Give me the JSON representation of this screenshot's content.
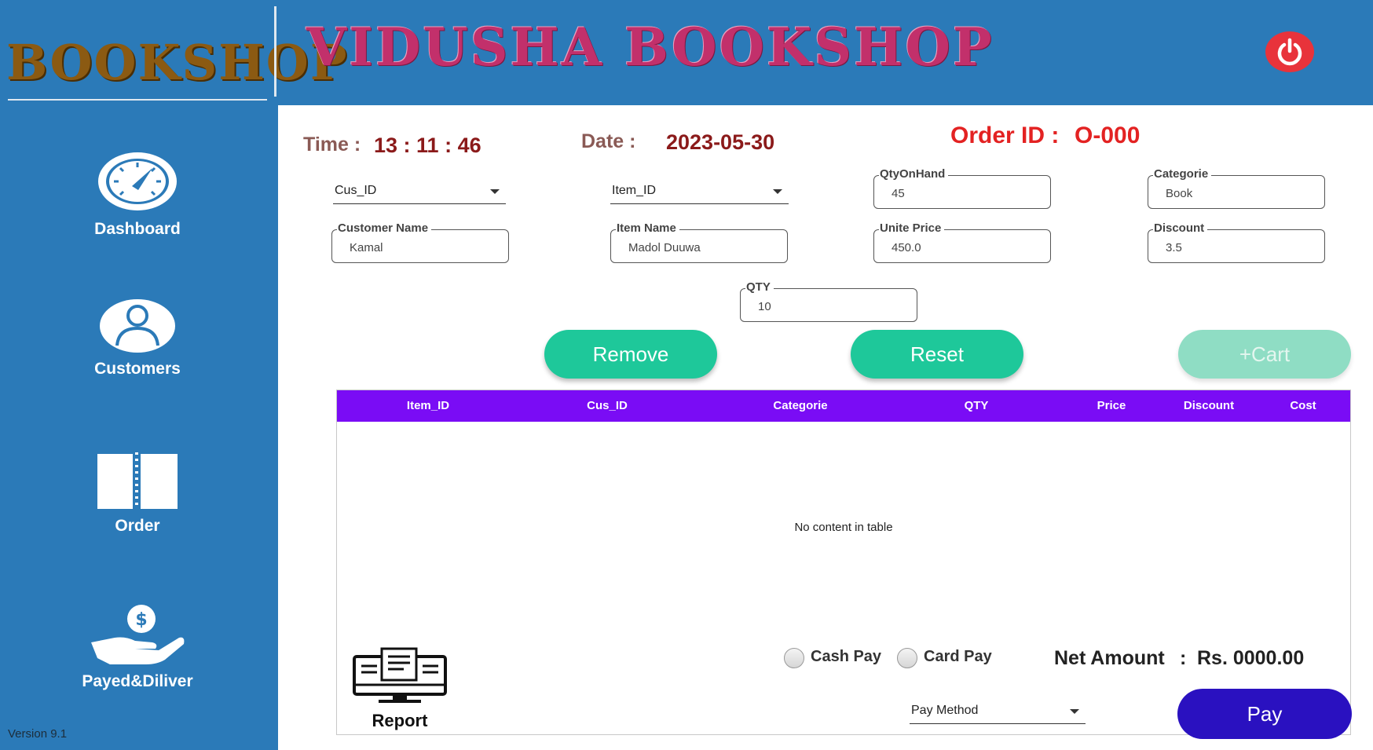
{
  "sidebar": {
    "logo_text": "BOOKSHOP",
    "items": [
      {
        "label": "Dashboard",
        "icon": "speedometer-icon"
      },
      {
        "label": "Customers",
        "icon": "user-icon"
      },
      {
        "label": "Order",
        "icon": "book-icon"
      },
      {
        "label": "Payed&Diliver",
        "icon": "dollar-hand-icon"
      }
    ],
    "version": "Version 9.1"
  },
  "header": {
    "title": "VIDUSHA BOOKSHOP",
    "power_icon": "power-icon",
    "power_color": "#e8333b"
  },
  "info": {
    "time_label": "Time :",
    "time_value": "13 : 11 : 46",
    "date_label": "Date :",
    "date_value": "2023-05-30",
    "order_label": "Order ID :",
    "order_value": "O-000"
  },
  "form": {
    "cus_id": "Cus_ID",
    "item_id": "Item_ID",
    "qty_on_hand": {
      "label": "QtyOnHand",
      "value": "45"
    },
    "categorie": {
      "label": "Categorie",
      "value": "Book"
    },
    "customer_name": {
      "label": "Customer Name",
      "value": "Kamal"
    },
    "item_name": {
      "label": "Item Name",
      "value": "Madol Duuwa"
    },
    "unite_price": {
      "label": "Unite Price",
      "value": "450.0"
    },
    "discount": {
      "label": "Discount",
      "value": "3.5"
    },
    "qty": {
      "label": "QTY",
      "value": "10"
    }
  },
  "buttons": {
    "remove": "Remove",
    "reset": "Reset",
    "cart": "+Cart",
    "pay": "Pay"
  },
  "table": {
    "columns": [
      "Item_ID",
      "Cus_ID",
      "Categorie",
      "QTY",
      "Price",
      "Discount",
      "Cost"
    ],
    "empty_text": "No content in table",
    "header_color": "#7a0cf5"
  },
  "bottom": {
    "report_label": "Report",
    "cash_pay": "Cash Pay",
    "card_pay": "Card Pay",
    "net_amount_label": "Net Amount",
    "net_colon": ":",
    "net_amount_value": "Rs. 0000.00",
    "pay_method": "Pay Method"
  },
  "colors": {
    "sidebar": "#2b7ab8",
    "accent_button": "#1ec89a",
    "pay_button": "#2a11c0",
    "order_id": "#e32222"
  }
}
